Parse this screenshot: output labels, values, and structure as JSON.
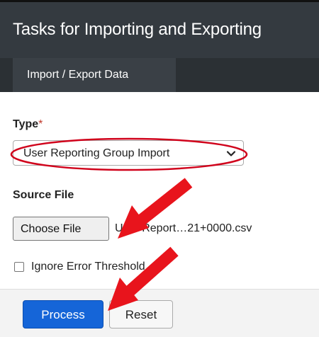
{
  "header": {
    "title": "Tasks for Importing and Exporting"
  },
  "tabs": [
    {
      "label": "Import / Export Data",
      "active": true
    }
  ],
  "form": {
    "type_label": "Type",
    "required_marker": "*",
    "type_value": "User Reporting Group Import",
    "source_file_label": "Source File",
    "choose_file_label": "Choose File",
    "file_name": "User Report…21+0000.csv",
    "ignore_error_label": "Ignore Error Threshold",
    "ignore_error_checked": false
  },
  "actions": {
    "process_label": "Process",
    "reset_label": "Reset"
  },
  "annotations": {
    "highlight_color": "#d0021b",
    "arrow_color": "#e8141c"
  },
  "colors": {
    "header_bg": "#343a40",
    "tab_bg": "#2b3034",
    "primary_button": "#1565d8"
  }
}
